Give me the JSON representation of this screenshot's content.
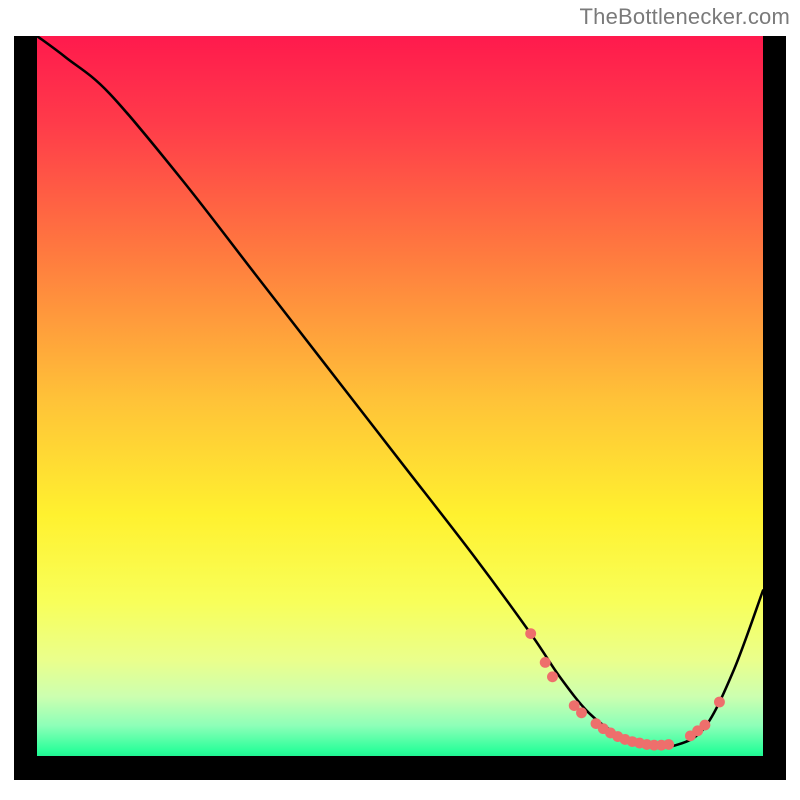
{
  "attribution": "TheBottlenecker.com",
  "chart_data": {
    "type": "line",
    "title": "",
    "xlabel": "",
    "ylabel": "",
    "xlim": [
      0,
      100
    ],
    "ylim": [
      0,
      100
    ],
    "gradient_stops": [
      {
        "offset": 0.0,
        "color": "#ff1a4d"
      },
      {
        "offset": 0.12,
        "color": "#ff3b4a"
      },
      {
        "offset": 0.3,
        "color": "#ff7a3f"
      },
      {
        "offset": 0.5,
        "color": "#ffc238"
      },
      {
        "offset": 0.66,
        "color": "#fff12f"
      },
      {
        "offset": 0.78,
        "color": "#f8ff5a"
      },
      {
        "offset": 0.86,
        "color": "#eaff8c"
      },
      {
        "offset": 0.91,
        "color": "#ccffb0"
      },
      {
        "offset": 0.95,
        "color": "#8dffb8"
      },
      {
        "offset": 0.985,
        "color": "#2bff9a"
      },
      {
        "offset": 1.0,
        "color": "#13e98a"
      }
    ],
    "series": [
      {
        "name": "bottleneck-curve",
        "x": [
          0,
          4,
          10,
          20,
          30,
          40,
          50,
          60,
          68,
          72,
          76,
          80,
          84,
          88,
          92,
          96,
          100
        ],
        "y": [
          100,
          97,
          92,
          80,
          67,
          54,
          41,
          28,
          17,
          11,
          6,
          3,
          1.5,
          1.5,
          4,
          12,
          23
        ]
      }
    ],
    "markers": {
      "name": "highlight-dots",
      "color": "#ee6f6c",
      "points": [
        {
          "x": 68,
          "y": 17
        },
        {
          "x": 70,
          "y": 13
        },
        {
          "x": 71,
          "y": 11
        },
        {
          "x": 74,
          "y": 7
        },
        {
          "x": 75,
          "y": 6
        },
        {
          "x": 77,
          "y": 4.5
        },
        {
          "x": 78,
          "y": 3.8
        },
        {
          "x": 79,
          "y": 3.2
        },
        {
          "x": 80,
          "y": 2.7
        },
        {
          "x": 81,
          "y": 2.3
        },
        {
          "x": 82,
          "y": 2.0
        },
        {
          "x": 83,
          "y": 1.8
        },
        {
          "x": 84,
          "y": 1.6
        },
        {
          "x": 85,
          "y": 1.5
        },
        {
          "x": 86,
          "y": 1.5
        },
        {
          "x": 87,
          "y": 1.6
        },
        {
          "x": 90,
          "y": 2.8
        },
        {
          "x": 91,
          "y": 3.5
        },
        {
          "x": 92,
          "y": 4.3
        },
        {
          "x": 94,
          "y": 7.5
        }
      ]
    }
  }
}
